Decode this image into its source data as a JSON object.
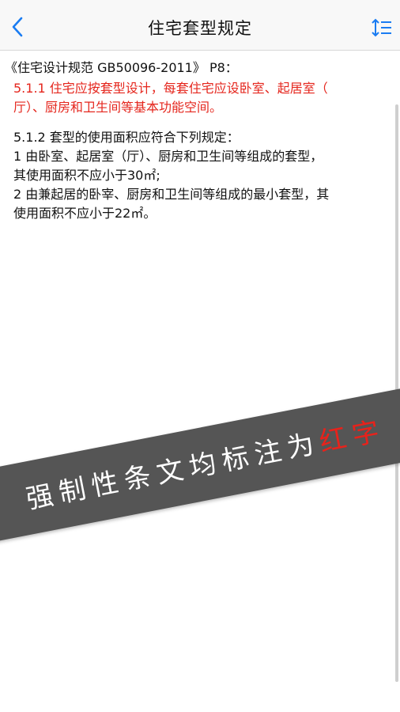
{
  "nav": {
    "title": "住宅套型规定",
    "back_icon": "chevron-left-icon",
    "sort_icon": "sort-icon",
    "accent_color": "#1a7cf2"
  },
  "content": {
    "heading": "《住宅设计规范 GB50096-2011》 P8：",
    "mandatory_lines": [
      "5.1.1  住宅应按套型设计，每套住宅应设卧室、起居室（",
      "厅）、厨房和卫生间等基本功能空间。"
    ],
    "clause_lines": [
      "5.1.2  套型的使用面积应符合下列规定：",
      "1 由卧室、起居室（厅）、厨房和卫生间等组成的套型，",
      "其使用面积不应小于30㎡;",
      "2 由兼起居的卧宰、厨房和卫生间等组成的最小套型，其",
      "使用面积不应小于22㎡。"
    ],
    "mandatory_color": "#e5261d"
  },
  "banner": {
    "text": "强制性条文均标注为",
    "highlight": "红字"
  }
}
